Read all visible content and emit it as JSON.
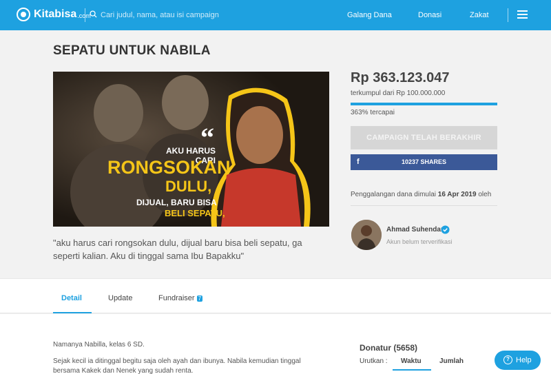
{
  "header": {
    "logo_text": "Kitabisa",
    "logo_domain": ".com",
    "search_placeholder": "Cari judul, nama, atau isi campaign",
    "nav": [
      "Galang Dana",
      "Donasi",
      "Zakat"
    ]
  },
  "campaign": {
    "title": "SEPATU UNTUK NABILA",
    "hero_text": {
      "quote_mark": "“",
      "line1": "AKU HARUS CARI",
      "line2": "RONGSOKAN",
      "line3": "DULU,",
      "line4": "DIJUAL, BARU BISA",
      "line5": "BELI SEPATU,"
    },
    "caption": "\"aku harus cari rongsokan dulu, dijual baru bisa beli sepatu, ga seperti kalian. Aku di tinggal sama Ibu Bapakku\"",
    "amount": "Rp 363.123.047",
    "collected_text": "terkumpul dari Rp 100.000.000",
    "progress_fraction": 1.0,
    "percent_text": "363% tercapai",
    "ended_button": "CAMPAIGN TELAH BERAKHIR",
    "share_label": "10237 SHARES",
    "share_icon": "f",
    "started_prefix": "Penggalangan dana dimulai",
    "started_date": "16 Apr 2019",
    "started_suffix": "oleh",
    "organizer_name": "Ahmad Suhendar",
    "organizer_desc": "Akun belum terverifikasi"
  },
  "tabs": [
    {
      "label": "Detail",
      "active": true
    },
    {
      "label": "Update",
      "active": false
    },
    {
      "label": "Fundraiser",
      "badge": "7",
      "active": false
    }
  ],
  "detail": {
    "story_line1": "Namanya Nabilla, kelas 6 SD.",
    "story_line2": "Sejak kecil ia ditinggal begitu saja oleh ayah dan ibunya. Nabila kemudian tinggal bersama Kakek dan Nenek yang sudah renta."
  },
  "donatur": {
    "title": "Donatur (5658)",
    "sort_label": "Urutkan :",
    "sort_options": [
      "Waktu",
      "Jumlah"
    ]
  },
  "help_button": "Help",
  "colors": {
    "brand": "#1ea1e0",
    "facebook": "#3b5998",
    "hero_yellow": "#f5c518"
  }
}
